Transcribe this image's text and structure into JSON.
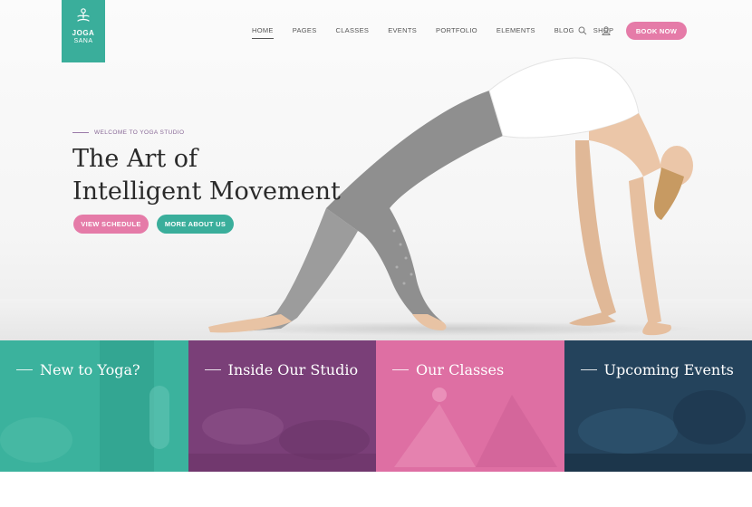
{
  "brand": {
    "line1": "JOGA",
    "line2": "SANA",
    "color": "#3aae9b"
  },
  "nav": {
    "items": [
      "HOME",
      "PAGES",
      "CLASSES",
      "EVENTS",
      "PORTFOLIO",
      "ELEMENTS",
      "BLOG",
      "SHOP"
    ],
    "active": "HOME",
    "search_icon": "search-icon",
    "user_icon": "user-icon",
    "book_label": "BOOK NOW"
  },
  "hero": {
    "kicker": "WELCOME TO YOGA STUDIO",
    "title_line1": "The Art of",
    "title_line2": "Intelligent Movement",
    "btn_primary": "VIEW SCHEDULE",
    "btn_secondary": "MORE ABOUT US"
  },
  "tiles": [
    {
      "label": "New to Yoga?",
      "color": "#3bb29d"
    },
    {
      "label": "Inside Our Studio",
      "color": "#7a3f78"
    },
    {
      "label": "Our Classes",
      "color": "#de6fa3"
    },
    {
      "label": "Upcoming Events",
      "color": "#24435c"
    }
  ],
  "colors": {
    "pink": "#e57ba8",
    "teal": "#3aae9b",
    "purple": "#7a3f78",
    "navy": "#24435c"
  }
}
